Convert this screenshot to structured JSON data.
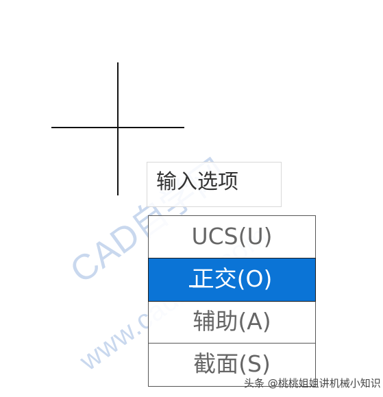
{
  "watermark": {
    "main": "CAD自学网",
    "sub": "www.cadzxw.com"
  },
  "prompt": {
    "label": "输入选项"
  },
  "menu": {
    "items": [
      {
        "label": "UCS(U)",
        "selected": false
      },
      {
        "label": "正交(O)",
        "selected": true
      },
      {
        "label": "辅助(A)",
        "selected": false
      },
      {
        "label": "截面(S)",
        "selected": false
      }
    ]
  },
  "caption": {
    "text": "头条 @桃桃姐姐讲机械小知识"
  },
  "colors": {
    "selection": "#0b74d6",
    "watermark": "#c9d8ee"
  }
}
